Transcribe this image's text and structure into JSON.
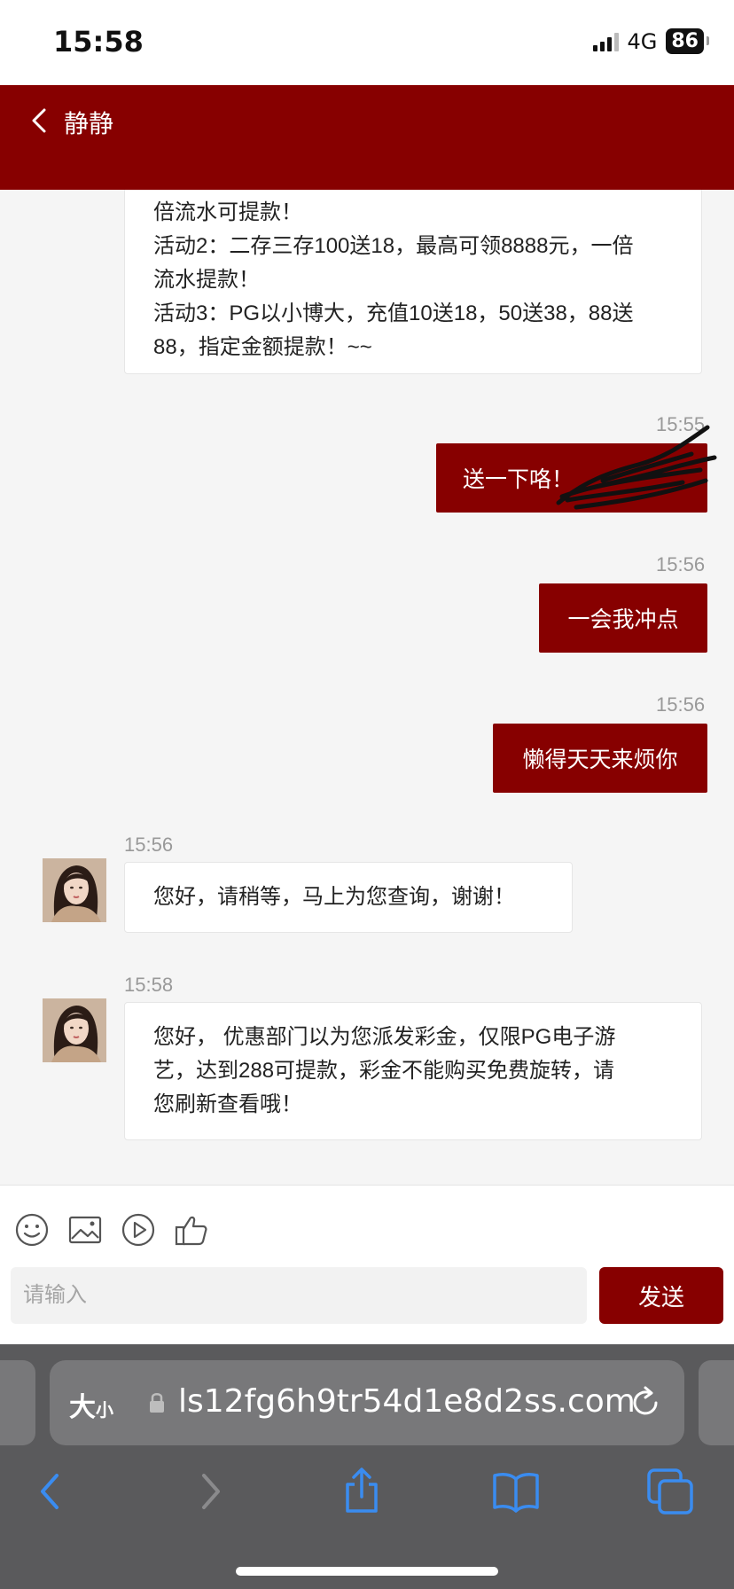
{
  "status": {
    "time": "15:58",
    "network": "4G",
    "battery": "86"
  },
  "header": {
    "title": "静静"
  },
  "messages": {
    "m1_lines": [
      "倍流水可提款！",
      "活动2：二存三存100送18，最高可领8888元，一倍",
      "流水提款！",
      "活动3：PG以小博大，充值10送18，50送38，88送",
      "88，指定金额提款！~~"
    ],
    "m2_time": "15:55",
    "m2_text": "送一下咯！",
    "m3_time": "15:56",
    "m3_text": "一会我冲点",
    "m4_time": "15:56",
    "m4_text": "懒得天天来烦你",
    "m5_time": "15:56",
    "m5_text": "您好，请稍等，马上为您查询，谢谢！",
    "m6_time": "15:58",
    "m6_lines": [
      "您好， 优惠部门以为您派发彩金，仅限PG电子游",
      "艺，达到288可提款，彩金不能购买免费旋转，请",
      "您刷新查看哦！"
    ]
  },
  "composer": {
    "placeholder": "请输入",
    "send_label": "发送"
  },
  "browser": {
    "text_size_label": "大",
    "text_size_small": "小",
    "url": "ls12fg6h9tr54d1e8d2ss.com"
  },
  "colors": {
    "brand": "#870000"
  },
  "icons": [
    "back-icon",
    "emoji-icon",
    "image-icon",
    "video-icon",
    "thumbs-up-icon",
    "lock-icon",
    "reload-icon",
    "browser-back-icon",
    "browser-forward-icon",
    "share-icon",
    "bookmarks-icon",
    "tabs-icon"
  ]
}
